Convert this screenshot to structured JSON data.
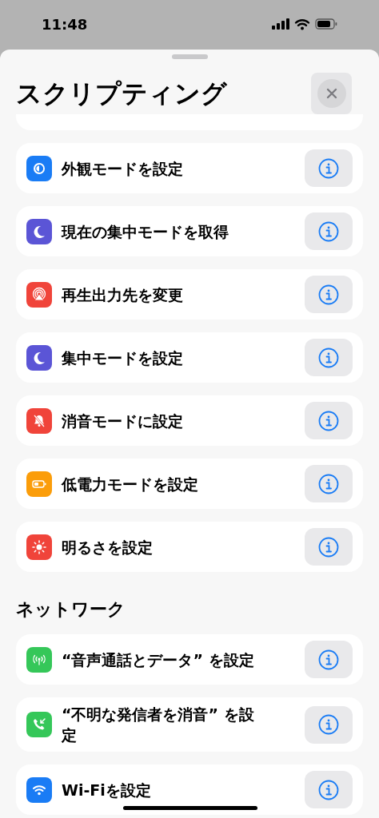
{
  "status_bar": {
    "time": "11:48"
  },
  "sheet": {
    "title": "スクリプティング"
  },
  "sections": [
    {
      "items": [
        {
          "label": "外観モードを設定",
          "kind": "appearance",
          "color": "#1a7cf5"
        },
        {
          "label": "現在の集中モードを取得",
          "kind": "moon",
          "color": "#5b55d6"
        },
        {
          "label": "再生出力先を変更",
          "kind": "airplay",
          "color": "#f0443a"
        },
        {
          "label": "集中モードを設定",
          "kind": "moon",
          "color": "#5b55d6"
        },
        {
          "label": "消音モードに設定",
          "kind": "bell",
          "color": "#f0443a"
        },
        {
          "label": "低電力モードを設定",
          "kind": "battery",
          "color": "#fb9d0a"
        },
        {
          "label": "明るさを設定",
          "kind": "sun",
          "color": "#f0443a"
        }
      ]
    },
    {
      "title": "ネットワーク",
      "items": [
        {
          "label": "“音声通話とデータ” を設定",
          "kind": "antenna",
          "color": "#35c759"
        },
        {
          "label": "“不明な発信者を消音” を設定",
          "kind": "phone",
          "color": "#35c759"
        },
        {
          "label": "Wi-Fiを設定",
          "kind": "wifi",
          "color": "#1a7cf5"
        }
      ]
    }
  ]
}
